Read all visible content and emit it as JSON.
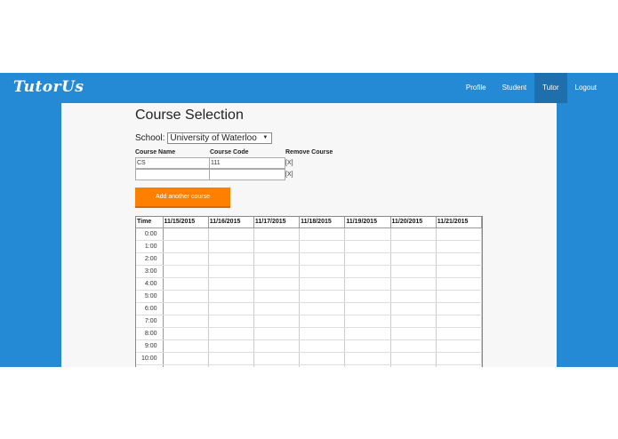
{
  "brand": "TutorUs",
  "nav": [
    {
      "label": "Profile",
      "active": false
    },
    {
      "label": "Student",
      "active": false
    },
    {
      "label": "Tutor",
      "active": true
    },
    {
      "label": "Logout",
      "active": false
    }
  ],
  "page_title": "Course Selection",
  "school": {
    "label": "School:",
    "selected": "University of Waterloo"
  },
  "courses": {
    "headers": [
      "Course Name",
      "Course Code",
      "Remove Course"
    ],
    "rows": [
      {
        "name": "CS",
        "code": "111",
        "remove": "[X]"
      },
      {
        "name": "",
        "code": "",
        "remove": "[X]"
      }
    ]
  },
  "add_button": "Add another course",
  "schedule": {
    "time_header": "Time",
    "dates": [
      "11/15/2015",
      "11/16/2015",
      "11/17/2015",
      "11/18/2015",
      "11/19/2015",
      "11/20/2015",
      "11/21/2015"
    ],
    "times": [
      "0:00",
      "1:00",
      "2:00",
      "3:00",
      "4:00",
      "5:00",
      "6:00",
      "7:00",
      "8:00",
      "9:00",
      "10:00",
      ""
    ]
  },
  "colors": {
    "header_bg": "#258ad6",
    "active_nav": "#1f6fad",
    "button": "#ff8000"
  }
}
